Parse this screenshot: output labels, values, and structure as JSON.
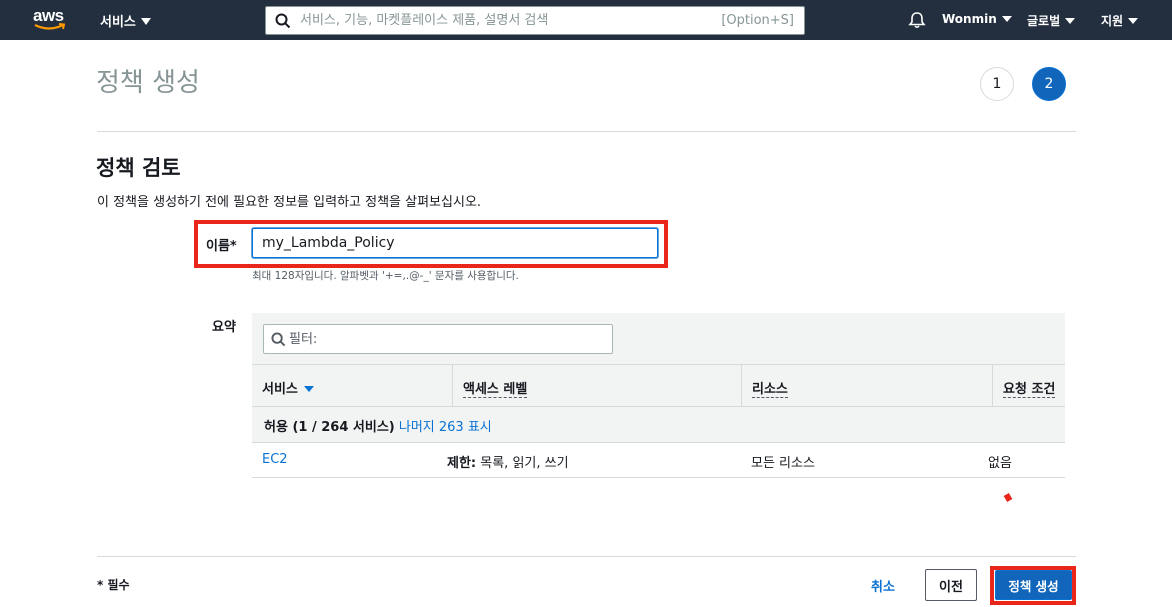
{
  "topnav": {
    "logo_text": "aws",
    "services_label": "서비스",
    "search_placeholder": "서비스, 기능, 마켓플레이스 제품, 설명서 검색",
    "search_shortcut": "[Option+S]",
    "user_label": "Wonmin",
    "region_label": "글로벌",
    "support_label": "지원",
    "bg_color": "#232f3e"
  },
  "header": {
    "title": "정책 생성",
    "steps": [
      "1",
      "2"
    ],
    "current_step": "2"
  },
  "review": {
    "title": "정책 검토",
    "description": "이 정책을 생성하기 전에 필요한 정보를 입력하고 정책을 살펴보십시오.",
    "name_label": "이름*",
    "name_value": "my_Lambda_Policy",
    "name_hint": "최대 128자입니다. 알파벳과 '+=,.@-_' 문자를 사용합니다."
  },
  "summary": {
    "label": "요약",
    "filter_placeholder": "필터:",
    "columns": [
      "서비스",
      "액세스 레벨",
      "리소스",
      "요청 조건"
    ],
    "group": {
      "bold": "허용 (1 / 264 서비스)",
      "link": "나머지 263 표시"
    },
    "rows": [
      {
        "service": "EC2",
        "access_bold": "제한:",
        "access_rest": "목록, 읽기, 쓰기",
        "resource": "모든 리소스",
        "condition": "없음"
      }
    ]
  },
  "footer": {
    "required_note": "* 필수",
    "cancel_label": "취소",
    "prev_label": "이전",
    "create_label": "정책 생성"
  },
  "colors": {
    "accent": "#0972d3",
    "highlight": "#e8261a"
  },
  "icons": [
    "search-icon",
    "bell-icon",
    "filter-search-icon",
    "caret-down-icon"
  ]
}
